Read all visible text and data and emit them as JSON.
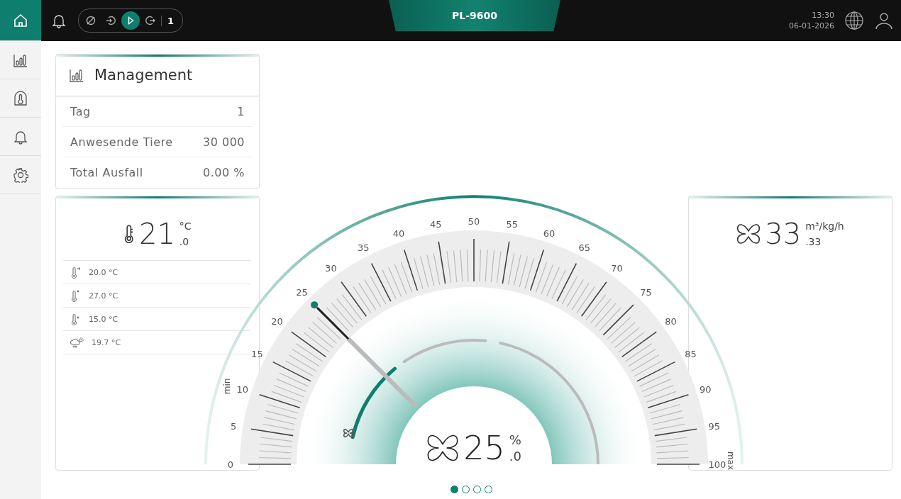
{
  "sidebar": {
    "items": [
      {
        "kind": "home",
        "selected": true
      },
      {
        "kind": "chart",
        "selected": false
      },
      {
        "kind": "climate",
        "selected": false
      },
      {
        "kind": "alarm",
        "selected": false
      },
      {
        "kind": "settings",
        "selected": false
      }
    ]
  },
  "top_bar": {
    "modes": [
      {
        "kind": "off",
        "selected": false
      },
      {
        "kind": "enter",
        "selected": false
      },
      {
        "kind": "play",
        "selected": true
      },
      {
        "kind": "exit",
        "selected": false
      }
    ],
    "mode_count": "1",
    "title": "PL-9600",
    "time": "13:30",
    "date": "06-01-2026"
  },
  "management": {
    "title": "Management",
    "rows": [
      {
        "label": "Tag",
        "value": "1"
      },
      {
        "label": "Anwesende Tiere",
        "value": "30 000"
      },
      {
        "label": "Total Ausfall",
        "value": "0.00 %"
      }
    ]
  },
  "temperature": {
    "value": "21",
    "decimal": ".0",
    "unit": "°C",
    "rows": [
      {
        "kind": "heating",
        "value": "20.0 °C"
      },
      {
        "kind": "max",
        "value": "27.0 °C"
      },
      {
        "kind": "min",
        "value": "15.0 °C"
      },
      {
        "kind": "outside",
        "value": "19.7 °C"
      }
    ]
  },
  "ventilation": {
    "value": "33",
    "decimal": ".33",
    "unit": "m³/kg/h"
  },
  "gauge": {
    "ticks": [
      "0",
      "5",
      "10",
      "15",
      "20",
      "25",
      "30",
      "35",
      "40",
      "45",
      "50",
      "55",
      "60",
      "65",
      "70",
      "75",
      "80",
      "85",
      "90",
      "95",
      "100"
    ],
    "min_label": "min",
    "max_label": "max",
    "needle": {
      "level": 0.25
    },
    "output": {
      "level": 0.28
    },
    "value": "25",
    "decimal": ".0",
    "unit": "%"
  },
  "pages": [
    {
      "selected": true
    },
    {
      "selected": false
    },
    {
      "selected": false
    },
    {
      "selected": false
    }
  ]
}
